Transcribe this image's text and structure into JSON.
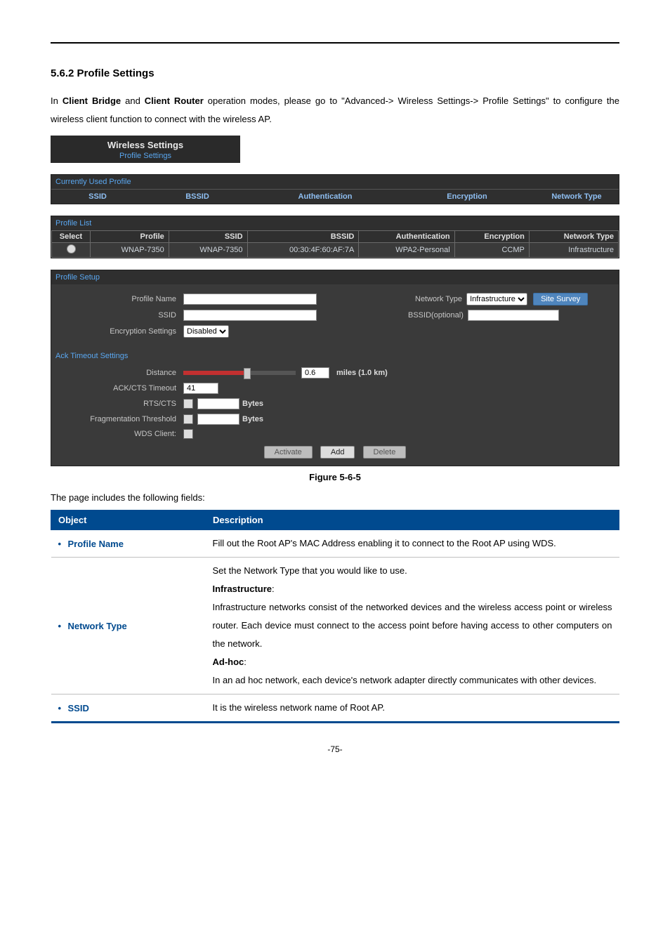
{
  "heading": "5.6.2  Profile Settings",
  "intro_parts": {
    "p1": "In ",
    "b1": "Client Bridge",
    "p2": " and ",
    "b2": "Client Router",
    "p3": " operation modes, please go to \"Advanced-> Wireless Settings-> Profile Settings\" to configure the wireless client function to connect with the wireless AP."
  },
  "tab": {
    "title": "Wireless Settings",
    "sub": "Profile Settings"
  },
  "cup": {
    "section": "Currently Used Profile",
    "hdr_ssid": "SSID",
    "hdr_bssid": "BSSID",
    "hdr_auth": "Authentication",
    "hdr_enc": "Encryption",
    "hdr_nt": "Network Type"
  },
  "plist": {
    "section": "Profile List",
    "h_select": "Select",
    "h_profile": "Profile",
    "h_ssid": "SSID",
    "h_bssid": "BSSID",
    "h_auth": "Authentication",
    "h_enc": "Encryption",
    "h_nt": "Network Type",
    "row": {
      "profile": "WNAP-7350",
      "ssid": "WNAP-7350",
      "bssid": "00:30:4F:60:AF:7A",
      "auth": "WPA2-Personal",
      "enc": "CCMP",
      "nt": "Infrastructure"
    }
  },
  "psu": {
    "section": "Profile Setup",
    "l_profile_name": "Profile Name",
    "l_network_type": "Network Type",
    "v_network_type": "Infrastructure",
    "btn_site_survey": "Site Survey",
    "l_ssid": "SSID",
    "l_bssid_opt": "BSSID(optional)",
    "l_enc": "Encryption Settings",
    "v_enc": "Disabled",
    "ack_section": "Ack Timeout Settings",
    "l_distance": "Distance",
    "v_distance": "0.6",
    "u_distance": "miles (1.0 km)",
    "l_ackcts": "ACK/CTS Timeout",
    "v_ackcts": "41",
    "l_rtscts": "RTS/CTS",
    "u_bytes": "Bytes",
    "l_frag": "Fragmentation Threshold",
    "l_wds": "WDS Client:",
    "btn_activate": "Activate",
    "btn_add": "Add",
    "btn_delete": "Delete"
  },
  "figcap": "Figure 5-6-5",
  "follow": "The page includes the following fields:",
  "table": {
    "h_object": "Object",
    "h_desc": "Description",
    "r1_obj": "Profile Name",
    "r1_txt": "Fill out the Root AP's MAC Address enabling it to connect to the Root AP using WDS.",
    "r2_obj": "Network Type",
    "r2_p1": "Set the Network Type that you would like to use.",
    "r2_b1": "Infrastructure",
    "r2_p2": "Infrastructure networks consist of the networked devices and the wireless access point or wireless router. Each device must connect to the access point before having access to other computers on the network.",
    "r2_b2": "Ad-hoc",
    "r2_p3": "In an ad hoc network, each device's network adapter directly communicates with other devices.",
    "r3_obj": "SSID",
    "r3_txt": "It is the wireless network name of Root AP."
  },
  "footer": "-75-"
}
